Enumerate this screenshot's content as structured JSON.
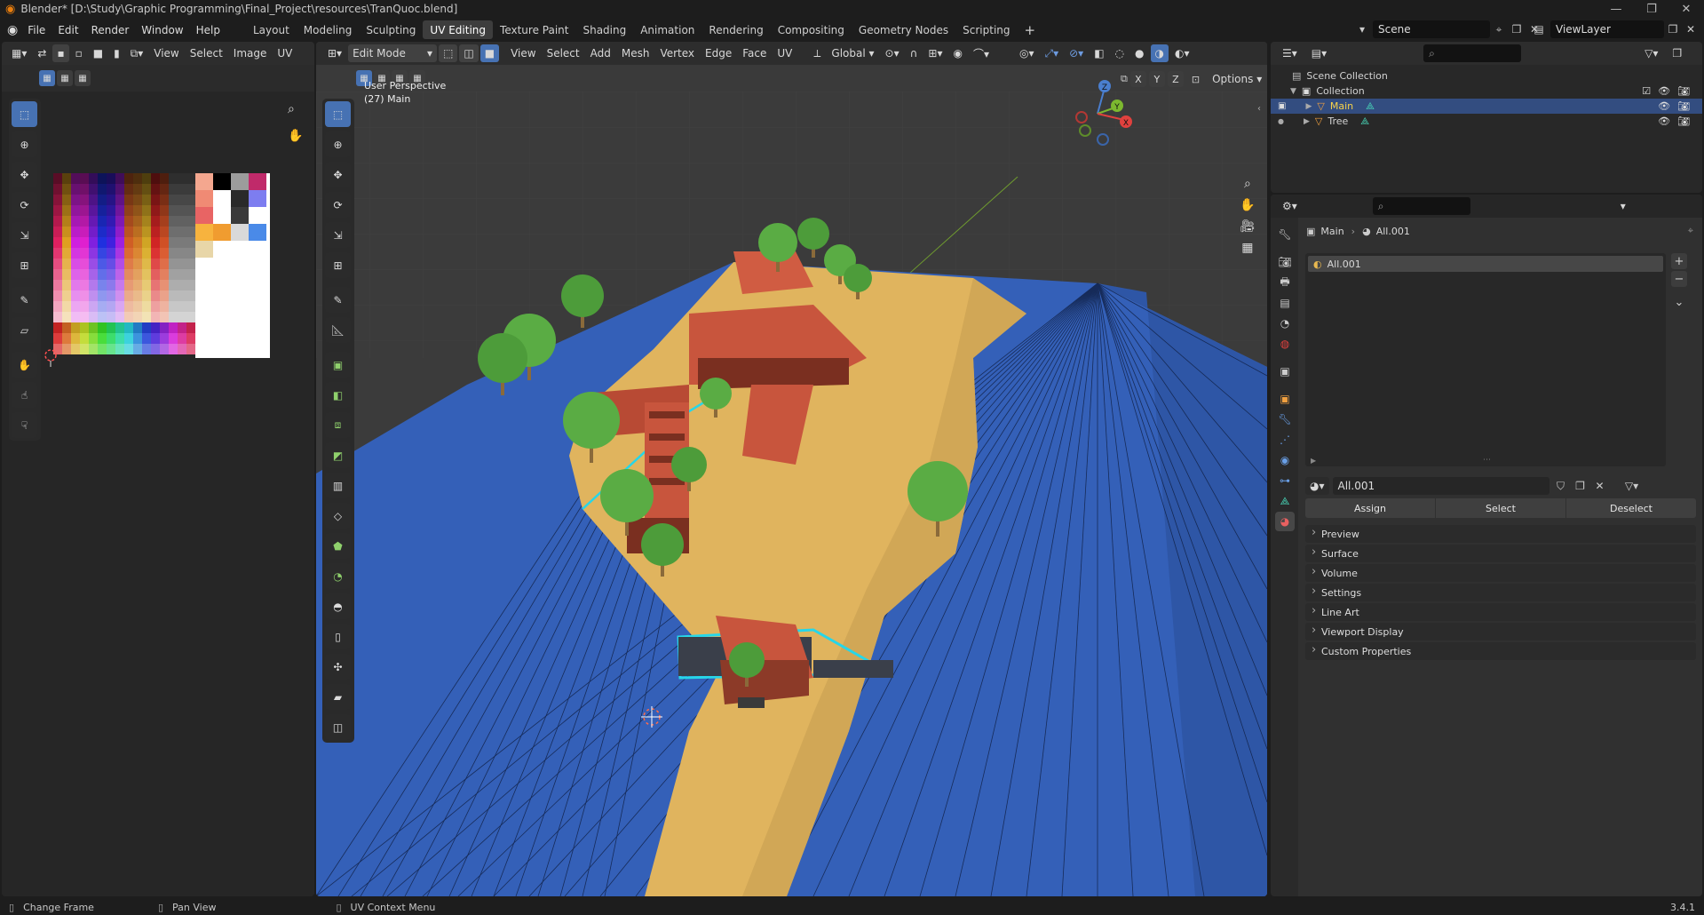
{
  "app": {
    "title": "Blender* [D:\\Study\\Graphic Programming\\Final_Project\\resources\\TranQuoc.blend]",
    "version": "3.4.1"
  },
  "menus": [
    "File",
    "Edit",
    "Render",
    "Window",
    "Help"
  ],
  "workspaces": [
    "Layout",
    "Modeling",
    "Sculpting",
    "UV Editing",
    "Texture Paint",
    "Shading",
    "Animation",
    "Rendering",
    "Compositing",
    "Geometry Nodes",
    "Scripting"
  ],
  "active_workspace": "UV Editing",
  "scene": {
    "name": "Scene",
    "view_layer": "ViewLayer"
  },
  "uv_editor": {
    "menus": [
      "View",
      "Select",
      "Image",
      "UV"
    ]
  },
  "viewport": {
    "mode": "Edit Mode",
    "menus": [
      "View",
      "Select",
      "Add",
      "Mesh",
      "Vertex",
      "Edge",
      "Face",
      "UV"
    ],
    "orientation": "Global",
    "overlay_title": "User Perspective",
    "overlay_object": "(27) Main",
    "axis_labels": {
      "x": "X",
      "y": "Y",
      "z": "Z"
    },
    "mirror_axes": [
      "X",
      "Y",
      "Z"
    ],
    "options_label": "Options"
  },
  "outliner": {
    "root": "Scene Collection",
    "collection": "Collection",
    "items": [
      {
        "name": "Main",
        "selected": true
      },
      {
        "name": "Tree",
        "selected": false
      }
    ]
  },
  "properties": {
    "breadcrumb_object": "Main",
    "breadcrumb_material": "All.001",
    "slot_name": "All.001",
    "material_name": "All.001",
    "buttons": {
      "assign": "Assign",
      "select": "Select",
      "deselect": "Deselect"
    },
    "panels": [
      "Preview",
      "Surface",
      "Volume",
      "Settings",
      "Line Art",
      "Viewport Display",
      "Custom Properties"
    ]
  },
  "status": {
    "left": "Change Frame",
    "middle": "Pan View",
    "right": "UV Context Menu"
  },
  "colors": {
    "accent": "#4772b3",
    "selection": "#334d80",
    "water": "#3460b8",
    "land": "#e0b45e",
    "roof": "#c8553d",
    "tree": "#4d9c3a",
    "edge_highlight": "#27d6e8"
  }
}
